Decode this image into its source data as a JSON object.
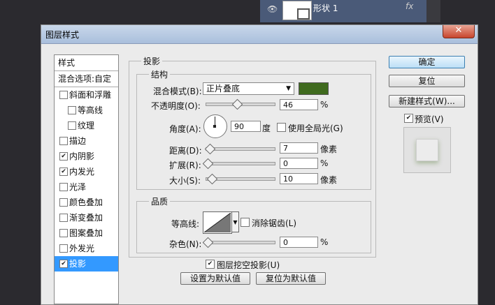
{
  "layer": {
    "name": "形状 1",
    "fx": "fx"
  },
  "dialog": {
    "title": "图层样式",
    "close": "✕"
  },
  "style_list": {
    "header": "样式",
    "blend_options": "混合选项:自定",
    "items": [
      {
        "label": "斜面和浮雕",
        "checked": false
      },
      {
        "label": "等高线",
        "checked": false
      },
      {
        "label": "纹理",
        "checked": false
      },
      {
        "label": "描边",
        "checked": false
      },
      {
        "label": "内阴影",
        "checked": true
      },
      {
        "label": "内发光",
        "checked": true
      },
      {
        "label": "光泽",
        "checked": false
      },
      {
        "label": "颜色叠加",
        "checked": false
      },
      {
        "label": "渐变叠加",
        "checked": false
      },
      {
        "label": "图案叠加",
        "checked": false
      },
      {
        "label": "外发光",
        "checked": false
      },
      {
        "label": "投影",
        "checked": true
      }
    ]
  },
  "shadow": {
    "group_title": "投影",
    "structure_title": "结构",
    "blend_mode_label": "混合模式(B):",
    "blend_mode_value": "正片叠底",
    "blend_color": "#3f6a1e",
    "opacity_label": "不透明度(O):",
    "opacity_value": "46",
    "opacity_unit": "%",
    "opacity_level": 0.46,
    "angle_label": "角度(A):",
    "angle_value": "90",
    "angle_unit": "度",
    "global_light_label": "使用全局光(G)",
    "global_light_checked": false,
    "distance_label": "距离(D):",
    "distance_value": "7",
    "distance_unit": "像素",
    "spread_label": "扩展(R):",
    "spread_value": "0",
    "spread_unit": "%",
    "size_label": "大小(S):",
    "size_value": "10",
    "size_unit": "像素",
    "quality_title": "品质",
    "contour_label": "等高线:",
    "antialias_label": "消除锯齿(L)",
    "antialias_checked": false,
    "noise_label": "杂色(N):",
    "noise_value": "0",
    "noise_unit": "%",
    "knockout_label": "图层挖空投影(U)",
    "knockout_checked": true,
    "set_default": "设置为默认值",
    "reset_default": "复位为默认值"
  },
  "buttons": {
    "ok": "确定",
    "reset": "复位",
    "new_style": "新建样式(W)...",
    "preview_label": "预览(V)",
    "preview_checked": true
  }
}
